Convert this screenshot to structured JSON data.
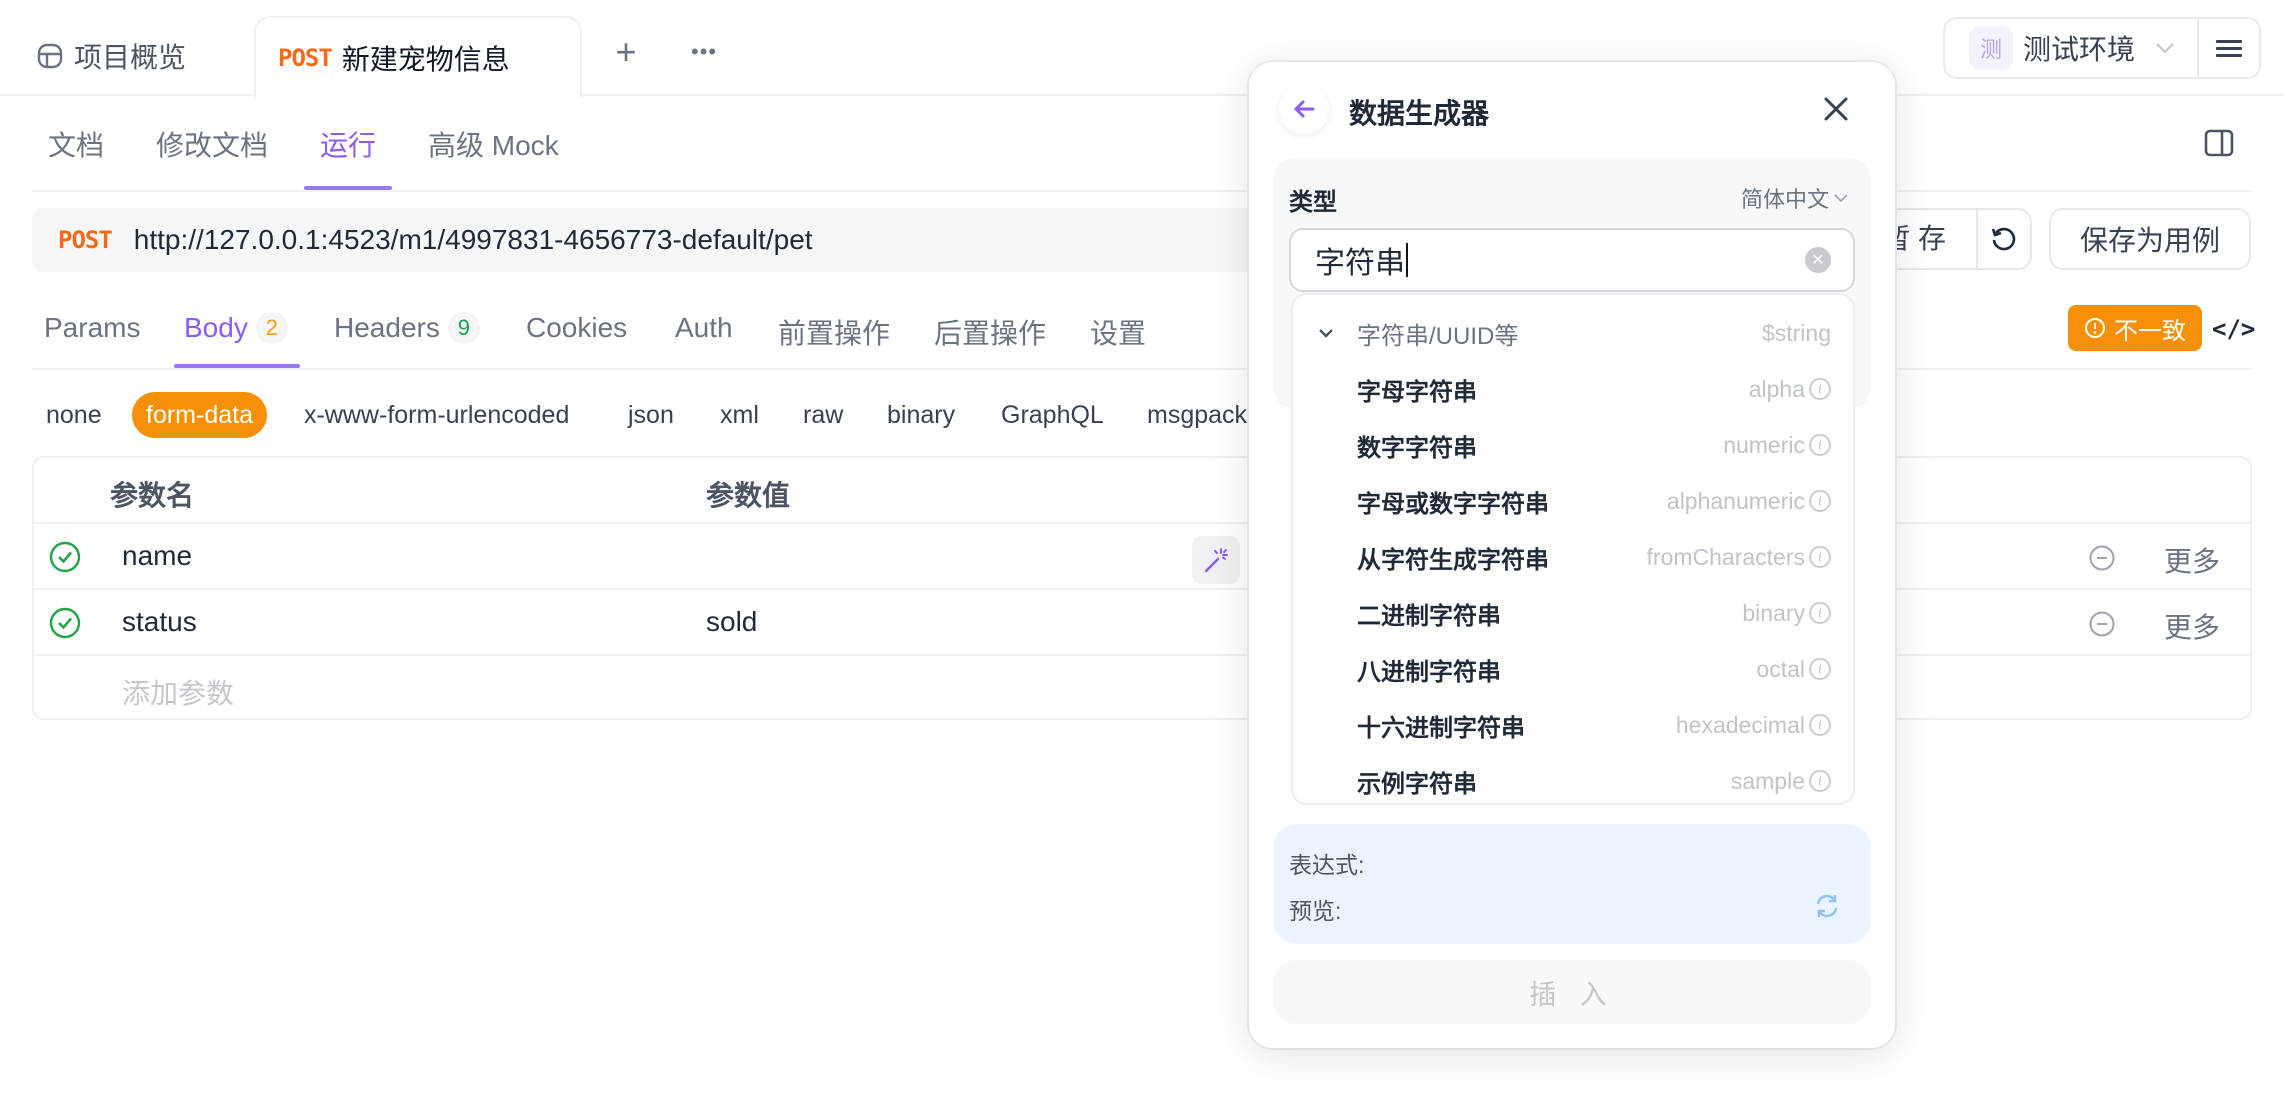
{
  "top_tabs": {
    "overview_label": "项目概览",
    "active_method": "POST",
    "active_label": "新建宠物信息",
    "add_icon": "+",
    "more_icon": "•••"
  },
  "environment": {
    "badge": "测",
    "label": "测试环境"
  },
  "sub_tabs": [
    {
      "label": "文档",
      "active": false
    },
    {
      "label": "修改文档",
      "active": false
    },
    {
      "label": "运行",
      "active": true
    },
    {
      "label": "高级 Mock",
      "active": false
    }
  ],
  "request": {
    "method": "POST",
    "url": "http://127.0.0.1:4523/m1/4997831-4656773-default/pet",
    "save_temp_label": "暂 存",
    "save_case_label": "保存为用例"
  },
  "request_tabs": [
    {
      "label": "Params"
    },
    {
      "label": "Body",
      "count": "2",
      "active": true
    },
    {
      "label": "Headers",
      "count": "9"
    },
    {
      "label": "Cookies"
    },
    {
      "label": "Auth"
    },
    {
      "label": "前置操作"
    },
    {
      "label": "后置操作"
    },
    {
      "label": "设置"
    }
  ],
  "mismatch_badge": "不一致",
  "code_icon": "</>",
  "body_types": [
    "none",
    "form-data",
    "x-www-form-urlencoded",
    "json",
    "xml",
    "raw",
    "binary",
    "GraphQL",
    "msgpack"
  ],
  "body_type_selected": "form-data",
  "params_table": {
    "headers": {
      "name": "参数名",
      "value": "参数值"
    },
    "rows": [
      {
        "name": "name",
        "value": "",
        "enabled": true,
        "more": "更多"
      },
      {
        "name": "status",
        "value": "sold",
        "enabled": true,
        "more": "更多"
      }
    ],
    "add_placeholder": "添加参数"
  },
  "generator": {
    "title": "数据生成器",
    "type_label": "类型",
    "language": "简体中文",
    "search_value": "字符串",
    "group": {
      "name": "字符串/UUID等",
      "key": "$string"
    },
    "items": [
      {
        "name": "字母字符串",
        "key": "alpha"
      },
      {
        "name": "数字字符串",
        "key": "numeric"
      },
      {
        "name": "字母或数字字符串",
        "key": "alphanumeric"
      },
      {
        "name": "从字符生成字符串",
        "key": "fromCharacters"
      },
      {
        "name": "二进制字符串",
        "key": "binary"
      },
      {
        "name": "八进制字符串",
        "key": "octal"
      },
      {
        "name": "十六进制字符串",
        "key": "hexadecimal"
      },
      {
        "name": "示例字符串",
        "key": "sample"
      }
    ],
    "expression_label": "表达式:",
    "preview_label": "预览:",
    "insert_label": "插 入"
  },
  "colors": {
    "accent": "#8b5cf6",
    "post_method": "#f26b1d",
    "orange": "#f59008",
    "success": "#16a34a"
  }
}
